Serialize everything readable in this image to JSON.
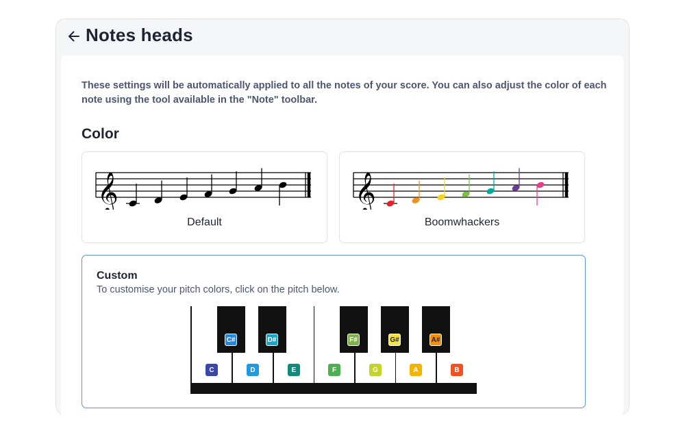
{
  "header": {
    "title": "Notes heads",
    "back_icon": "arrow-left-icon"
  },
  "description": "These settings will be automatically applied to all the notes of your score. You can also adjust the color of each note using the tool available in the \"Note\" toolbar.",
  "color_section": {
    "title": "Color",
    "options": [
      {
        "label": "Default",
        "note_colors": [
          "#000000",
          "#000000",
          "#000000",
          "#000000",
          "#000000",
          "#000000",
          "#000000"
        ]
      },
      {
        "label": "Boomwhackers",
        "note_colors": [
          "#e8202a",
          "#f3901d",
          "#f6d21b",
          "#7dc242",
          "#00a99d",
          "#6a3d9a",
          "#e83e8c"
        ]
      }
    ]
  },
  "custom": {
    "title": "Custom",
    "subtitle": "To customise your pitch colors, click on the pitch below.",
    "white_keys": [
      {
        "note": "C",
        "color": "#3947a8"
      },
      {
        "note": "D",
        "color": "#1e9be0"
      },
      {
        "note": "E",
        "color": "#0f8a7d"
      },
      {
        "note": "F",
        "color": "#4caf50"
      },
      {
        "note": "G",
        "color": "#c5d429"
      },
      {
        "note": "A",
        "color": "#f4b400"
      },
      {
        "note": "B",
        "color": "#f4511e"
      }
    ],
    "black_keys": [
      {
        "note": "C#",
        "color": "#1e88e5"
      },
      {
        "note": "D#",
        "color": "#0fa9c9"
      },
      {
        "note": "F#",
        "color": "#7cb342"
      },
      {
        "note": "G#",
        "color": "#f7e23e"
      },
      {
        "note": "A#",
        "color": "#fb8c00"
      }
    ]
  }
}
